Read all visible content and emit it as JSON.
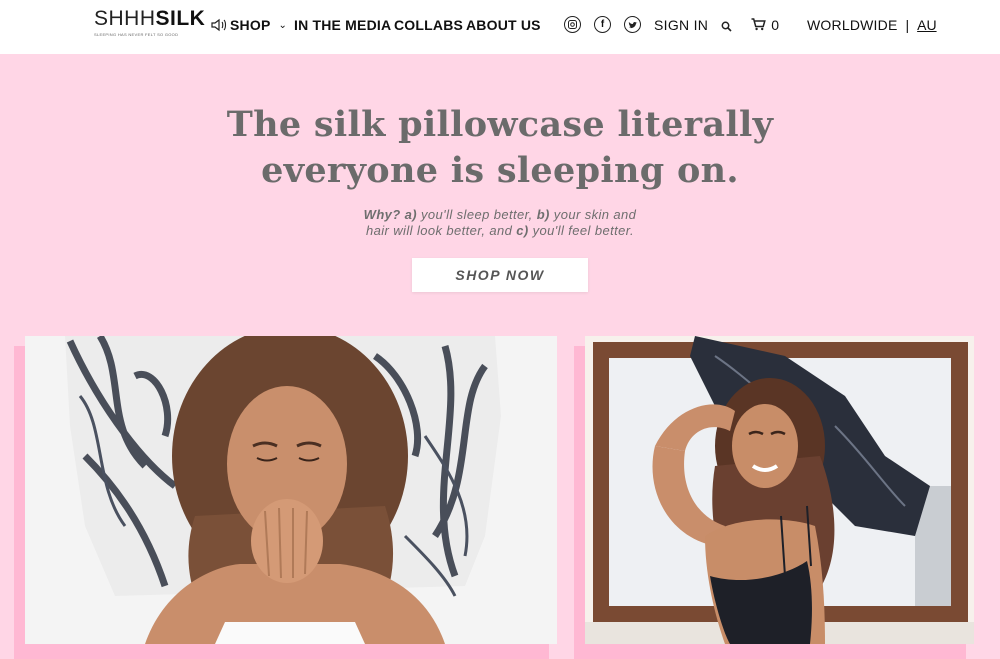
{
  "header": {
    "logo": {
      "text_light": "SHHH",
      "text_bold": "SILK",
      "tagline": "SLEEPING HAS NEVER FELT SO GOOD"
    },
    "nav": [
      {
        "label": "SHOP",
        "has_dropdown": true,
        "icon": "speaker-icon"
      },
      {
        "label": "IN THE MEDIA"
      },
      {
        "label": "COLLABS"
      },
      {
        "label": "ABOUT US"
      }
    ],
    "social": [
      "instagram-icon",
      "facebook-icon",
      "twitter-icon"
    ],
    "sign_in": "SIGN IN",
    "cart_count": "0",
    "region": "WORLDWIDE",
    "region_separator": "|",
    "region_current": "AU"
  },
  "hero": {
    "title_line1": "The silk pillowcase literally",
    "title_line2": "everyone is sleeping on.",
    "sub": {
      "why": "Why?",
      "a_label": "a)",
      "a_text": " you'll sleep better, ",
      "b_label": "b)",
      "b_text": " your skin and",
      "line2": "hair will look better, and ",
      "c_label": "c)",
      "c_text": " you'll feel better."
    },
    "cta": "SHOP NOW"
  },
  "photos": [
    {
      "subject": "woman lying on marble-print silk pillowcase"
    },
    {
      "subject": "woman holding marble silk pillow by window"
    }
  ],
  "colors": {
    "background": "#ffd6e6",
    "accent_shadow": "#ffb8d3",
    "heading": "#6b6b6b"
  }
}
